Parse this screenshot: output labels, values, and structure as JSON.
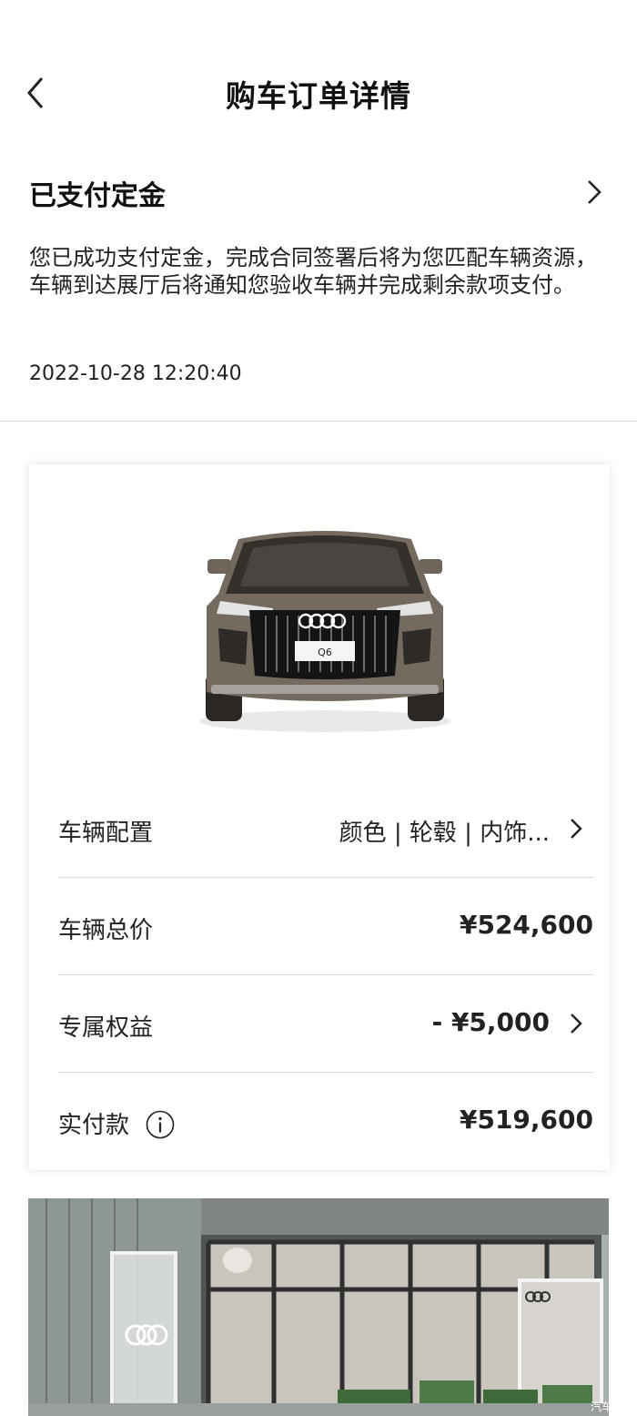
{
  "header": {
    "title": "购车订单详情"
  },
  "status": {
    "title": "已支付定金",
    "description": "您已成功支付定金，完成合同签署后将为您匹配车辆资源，车辆到达展厅后将通知您验收车辆并完成剩余款项支付。",
    "timestamp": "2022-10-28 12:20:40"
  },
  "car": {
    "plate": "Q6"
  },
  "rows": {
    "config": {
      "label": "车辆配置",
      "value": "颜色 | 轮毂 | 内饰..."
    },
    "total": {
      "label": "车辆总价",
      "value": "¥524,600"
    },
    "benefit": {
      "label": "专属权益",
      "value": "- ¥5,000"
    },
    "paid": {
      "label": "实付款",
      "value": "¥519,600"
    }
  },
  "showroom": {
    "watermark": "汽车"
  },
  "icons": [
    "back-icon",
    "chevron-right-icon",
    "info-icon"
  ],
  "colors": {
    "text": "#111111",
    "divider": "#d8d8d8",
    "card_bg": "#ffffff"
  }
}
